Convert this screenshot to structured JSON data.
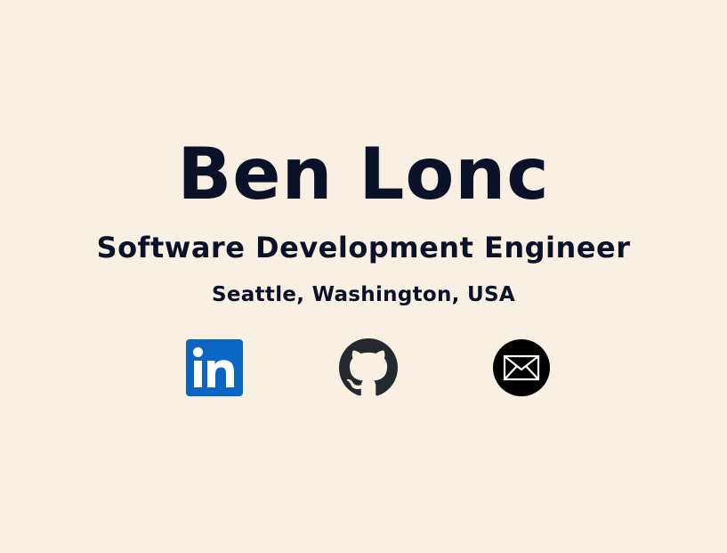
{
  "profile": {
    "name": "Ben Lonc",
    "title": "Software Development Engineer",
    "location": "Seattle, Washington, USA"
  },
  "links": [
    {
      "icon": "linkedin-icon",
      "label": "LinkedIn",
      "color": "#0a66c2"
    },
    {
      "icon": "github-icon",
      "label": "GitHub",
      "color": "#24292f"
    },
    {
      "icon": "envelope-icon",
      "label": "Email",
      "color": "#000000"
    }
  ],
  "colors": {
    "background": "#f8f0e2",
    "text": "#0a1128"
  }
}
